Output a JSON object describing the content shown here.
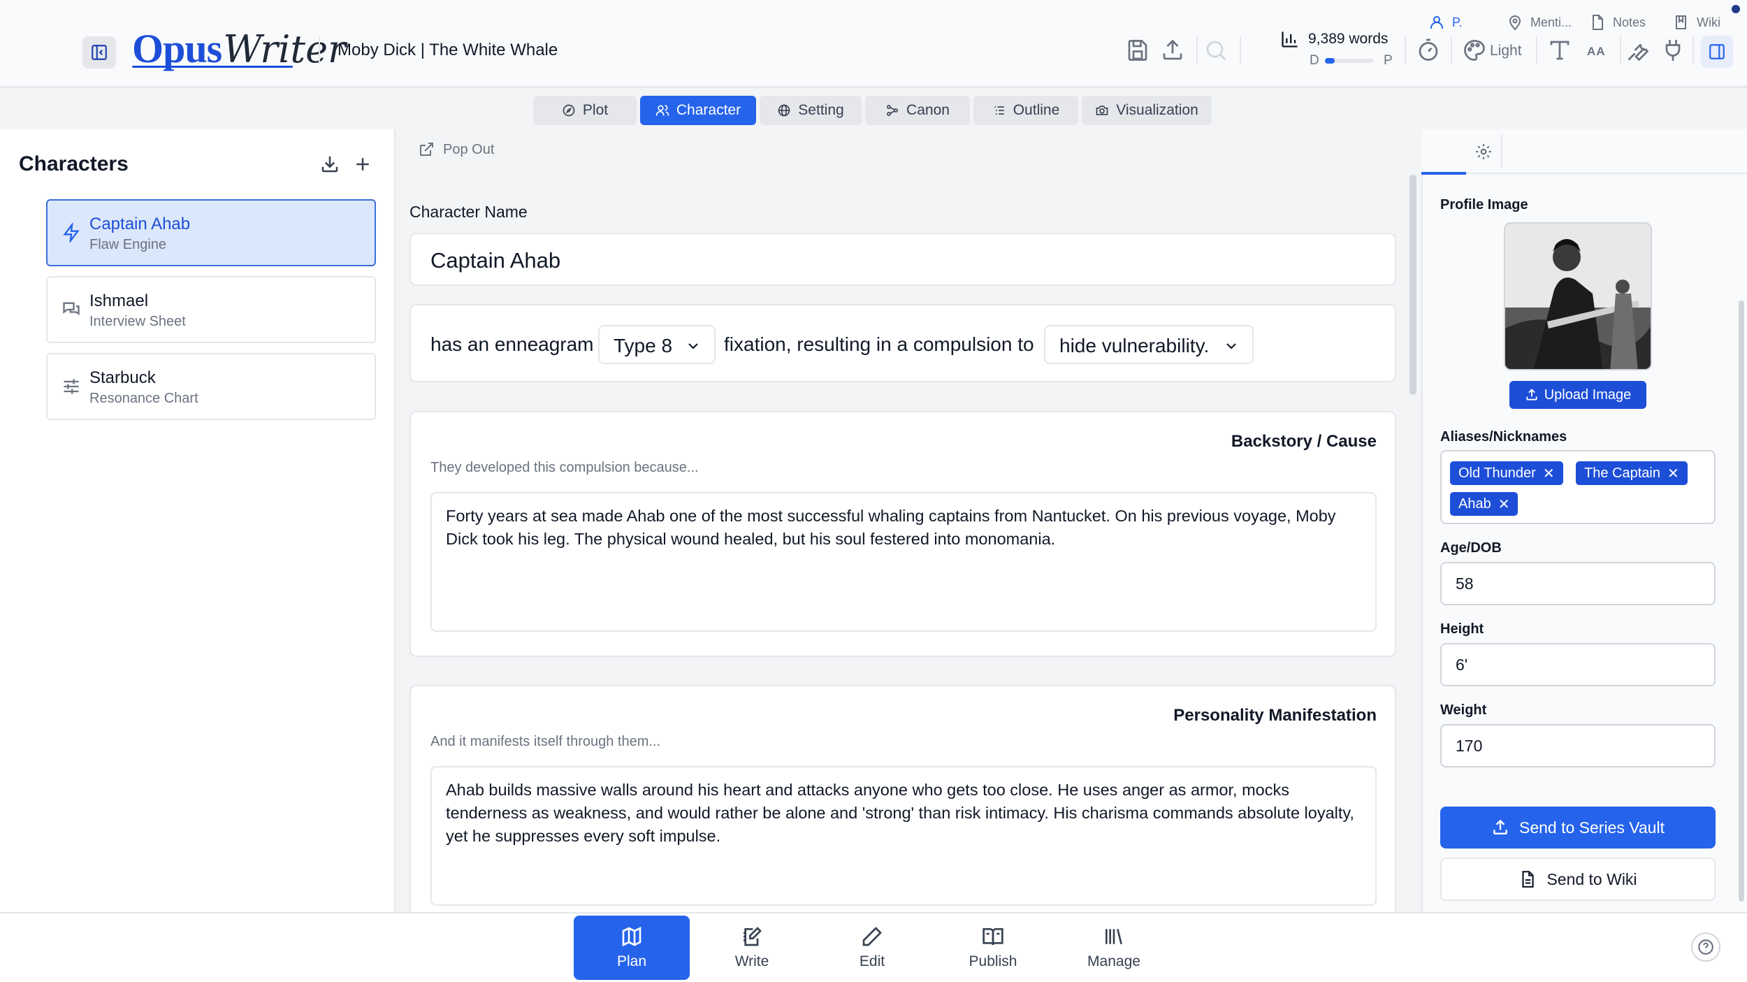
{
  "header": {
    "logo_main": "Opus",
    "logo_script": "Writer",
    "project_title": "Moby Dick | The White Whale",
    "word_count": "9,389 words",
    "progress_start": "D",
    "progress_end": "P",
    "progress_fraction": 0.2,
    "theme_label": "Light",
    "font_size_label": "AA"
  },
  "tabs": [
    {
      "label": "Plot",
      "icon": "compass-icon"
    },
    {
      "label": "Character",
      "icon": "users-icon",
      "active": true
    },
    {
      "label": "Setting",
      "icon": "globe-icon"
    },
    {
      "label": "Canon",
      "icon": "network-icon"
    },
    {
      "label": "Outline",
      "icon": "list-icon"
    },
    {
      "label": "Visualization",
      "icon": "camera-icon"
    }
  ],
  "sidebar": {
    "title": "Characters",
    "characters": [
      {
        "name": "Captain Ahab",
        "subtitle": "Flaw Engine",
        "icon": "bolt-icon",
        "selected": true
      },
      {
        "name": "Ishmael",
        "subtitle": "Interview Sheet",
        "icon": "chat-icon"
      },
      {
        "name": "Starbuck",
        "subtitle": "Resonance Chart",
        "icon": "sliders-icon"
      }
    ]
  },
  "main": {
    "popout_label": "Pop Out",
    "name_label": "Character Name",
    "name_value": "Captain Ahab",
    "ennea_prefix": "has an enneagram",
    "ennea_type": "Type 8",
    "ennea_middle": "fixation, resulting in a compulsion to",
    "ennea_compulsion": "hide vulnerability.",
    "backstory": {
      "title": "Backstory / Cause",
      "hint": "They developed this compulsion because...",
      "text": "Forty years at sea made Ahab one of the most successful whaling captains from Nantucket. On his previous voyage, Moby Dick took his leg. The physical wound healed, but his soul festered into monomania."
    },
    "personality": {
      "title": "Personality Manifestation",
      "hint": "And it manifests itself through them...",
      "text": "Ahab builds massive walls around his heart and attacks anyone who gets too close. He uses anger as armor, mocks tenderness as weakness, and would rather be alone and 'strong' than risk intimacy. His charisma commands absolute loyalty, yet he suppresses every soft impulse."
    }
  },
  "right_panel": {
    "tabs": [
      {
        "label": "P.",
        "icon": "person-icon",
        "active": true
      },
      {
        "label": "Menti...",
        "icon": "location-pin-icon"
      },
      {
        "label": "Notes",
        "icon": "document-icon"
      },
      {
        "label": "Wiki",
        "icon": "book-icon"
      }
    ],
    "profile_label": "Profile Image",
    "upload_label": "Upload Image",
    "aliases_label": "Aliases/Nicknames",
    "aliases": [
      "Old Thunder",
      "The Captain",
      "Ahab"
    ],
    "age_label": "Age/DOB",
    "age_value": "58",
    "height_label": "Height",
    "height_value": "6'",
    "weight_label": "Weight",
    "weight_value": "170",
    "vault_label": "Send to Series Vault",
    "wiki_label": "Send to Wiki"
  },
  "bottom_nav": [
    {
      "label": "Plan",
      "icon": "map-icon",
      "active": true
    },
    {
      "label": "Write",
      "icon": "notebook-pen-icon"
    },
    {
      "label": "Edit",
      "icon": "pen-icon"
    },
    {
      "label": "Publish",
      "icon": "open-book-icon"
    },
    {
      "label": "Manage",
      "icon": "library-icon"
    }
  ],
  "colors": {
    "accent": "#2563eb",
    "selected_card_bg": "#dbe7fb",
    "border": "#e5e7eb"
  }
}
